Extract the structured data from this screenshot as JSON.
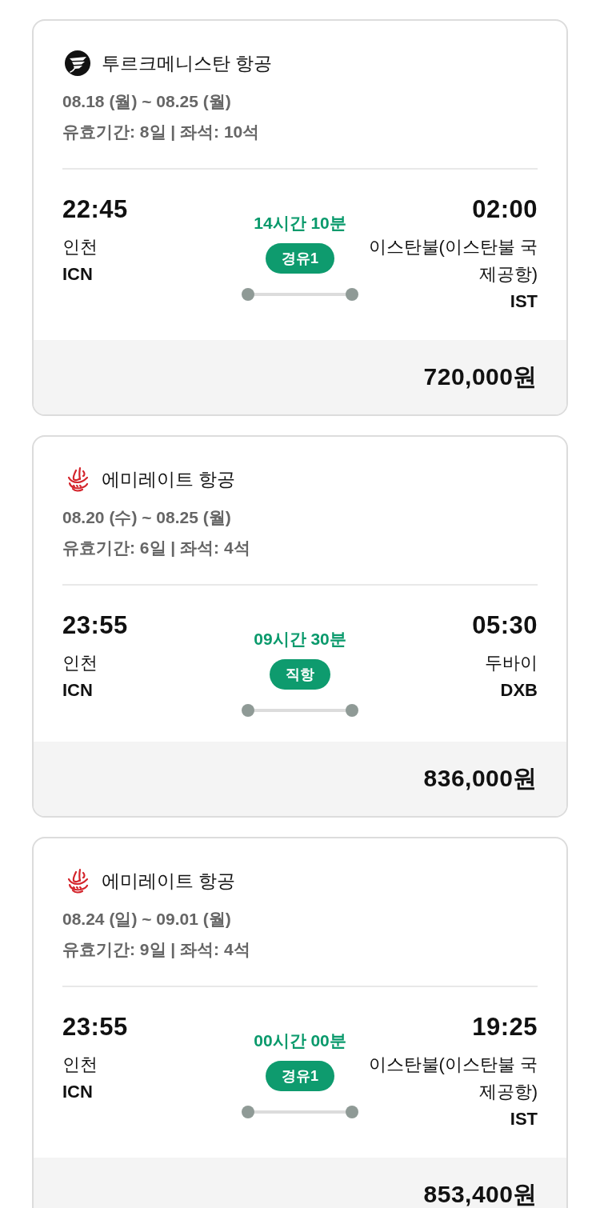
{
  "flights": [
    {
      "airline": {
        "kind": "disc",
        "name": "투르크메니스탄 항공"
      },
      "dates": "08.18 (월) ~ 08.25 (월)",
      "validity": "유효기간: 8일 | 좌석: 10석",
      "departure": {
        "time": "22:45",
        "city": "인천",
        "code": "ICN"
      },
      "duration": "14시간 10분",
      "stops": "경유1",
      "arrival": {
        "time": "02:00",
        "city": "이스탄불(이스탄불 국제공항)",
        "code": "IST"
      },
      "price": "720,000원"
    },
    {
      "airline": {
        "kind": "script",
        "name": "에미레이트 항공"
      },
      "dates": "08.20 (수) ~ 08.25 (월)",
      "validity": "유효기간: 6일 | 좌석: 4석",
      "departure": {
        "time": "23:55",
        "city": "인천",
        "code": "ICN"
      },
      "duration": "09시간 30분",
      "stops": "직항",
      "arrival": {
        "time": "05:30",
        "city": "두바이",
        "code": "DXB"
      },
      "price": "836,000원"
    },
    {
      "airline": {
        "kind": "script",
        "name": "에미레이트 항공"
      },
      "dates": "08.24 (일) ~ 09.01 (월)",
      "validity": "유효기간: 9일 | 좌석: 4석",
      "departure": {
        "time": "23:55",
        "city": "인천",
        "code": "ICN"
      },
      "duration": "00시간 00분",
      "stops": "경유1",
      "arrival": {
        "time": "19:25",
        "city": "이스탄불(이스탄불 국제공항)",
        "code": "IST"
      },
      "price": "853,400원"
    }
  ]
}
